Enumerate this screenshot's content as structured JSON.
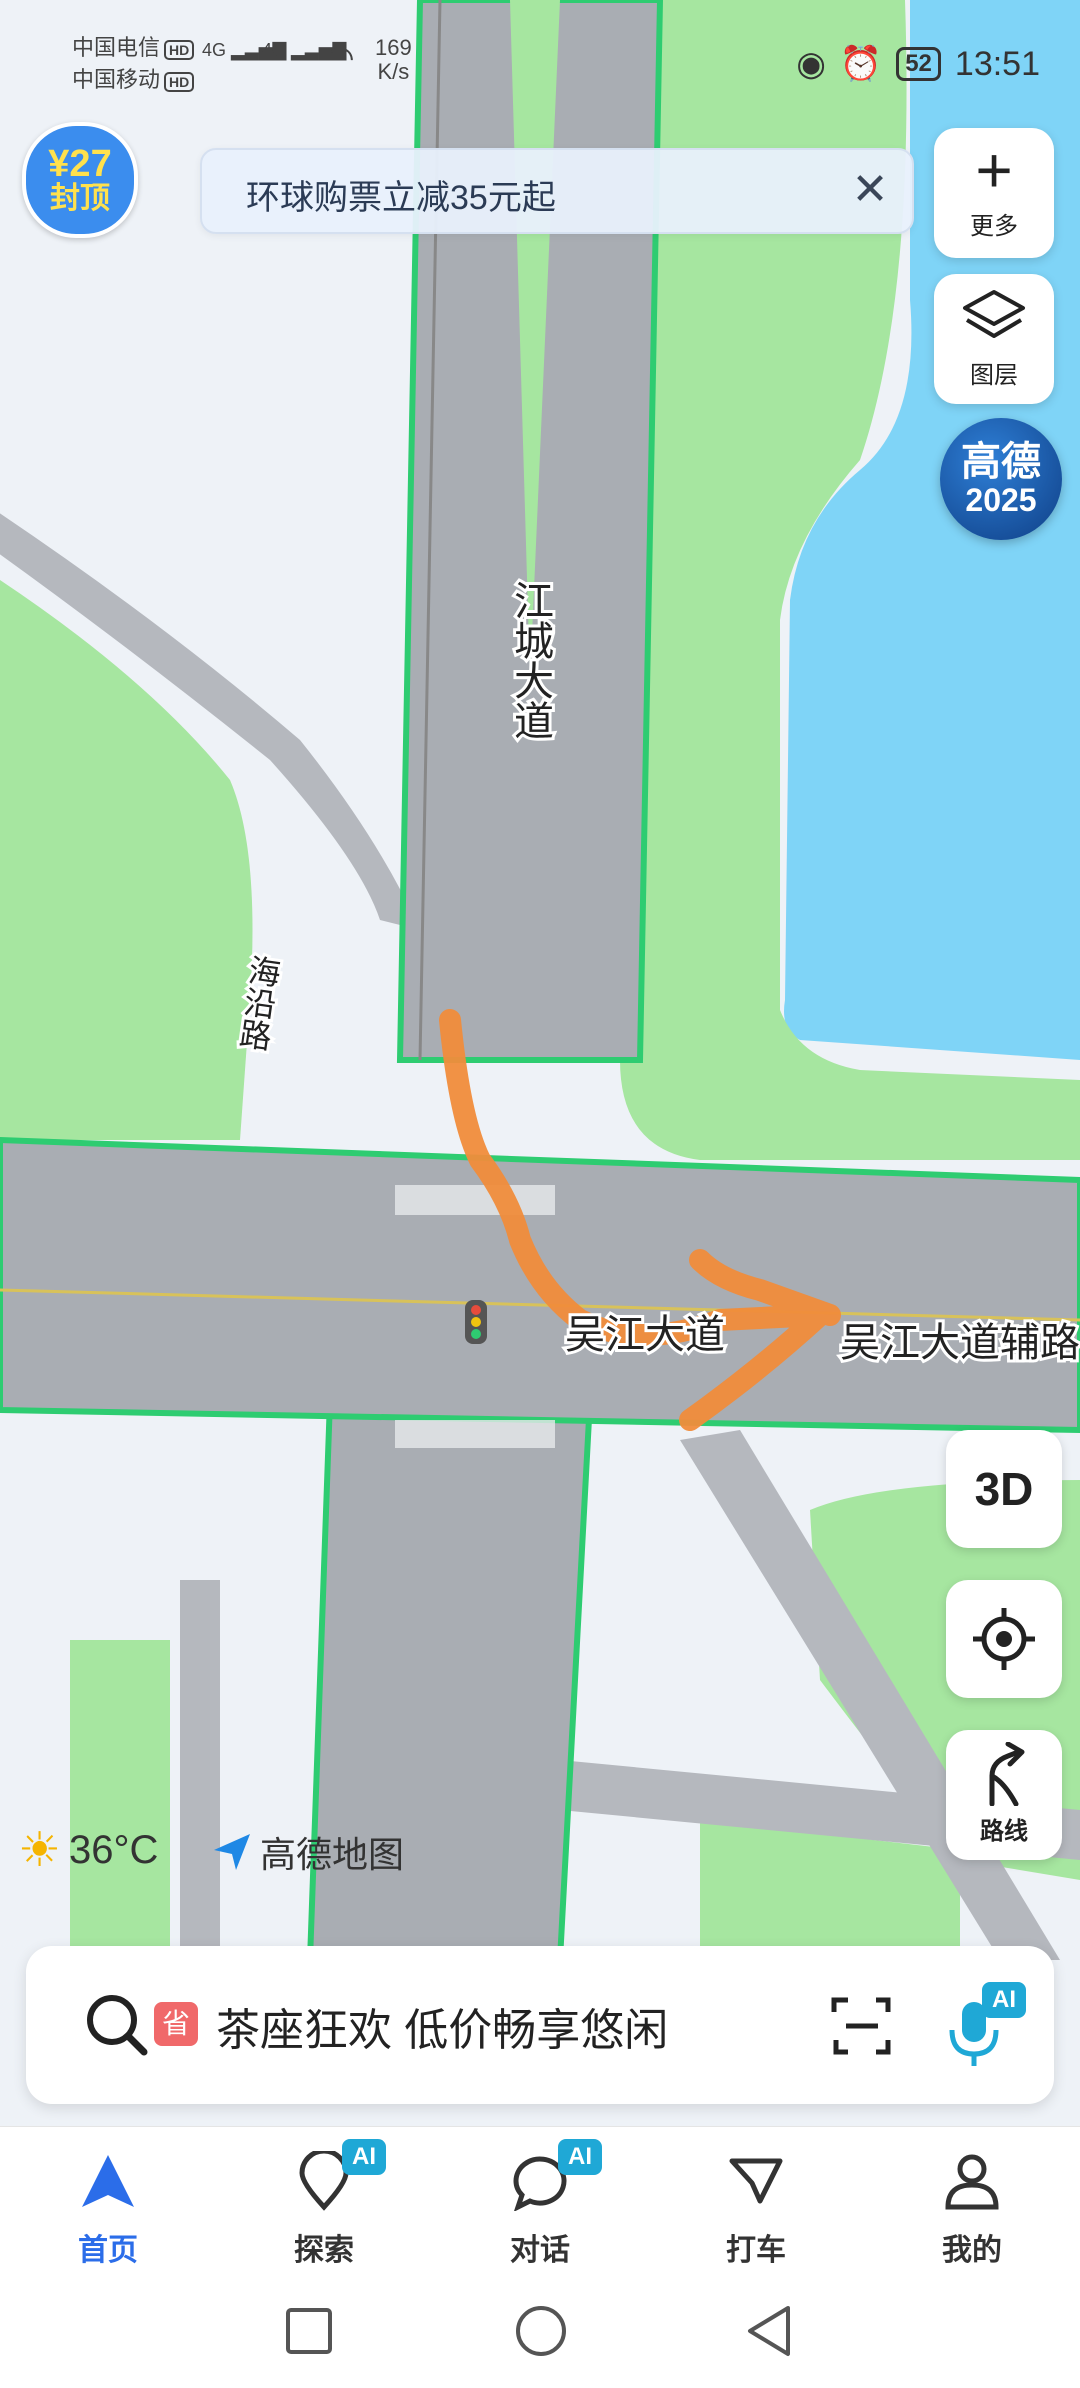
{
  "status_bar": {
    "carrier1": "中国电信",
    "carrier2": "中国移动",
    "hd_label": "HD",
    "net_label": "4G",
    "speed_value": "169",
    "speed_unit": "K/s",
    "battery": "52",
    "time": "13:51"
  },
  "promo_badge": {
    "line1": "¥27",
    "line2": "封顶"
  },
  "banner": {
    "text": "环球购票立减35元起"
  },
  "side_buttons": {
    "more_label": "更多",
    "layers_label": "图层"
  },
  "event_badge": {
    "line1": "高德",
    "line2": "2025"
  },
  "map": {
    "road_north": "江城大道",
    "road_west": "海沿路",
    "road_main": "吴江大道",
    "road_aux": "吴江大道辅路"
  },
  "controls": {
    "view_3d": "3D",
    "route_label": "路线"
  },
  "weather": {
    "temp": "36°C"
  },
  "logo": {
    "text": "高德地图"
  },
  "search": {
    "tag": "省",
    "placeholder": "茶座狂欢 低价畅享悠闲",
    "ai_label": "AI"
  },
  "tabs": [
    {
      "label": "首页",
      "active": true
    },
    {
      "label": "探索",
      "badge": "AI"
    },
    {
      "label": "对话",
      "badge": "AI"
    },
    {
      "label": "打车"
    },
    {
      "label": "我的"
    }
  ],
  "colors": {
    "accent": "#2b6de9",
    "road": "#a9adb3",
    "road_edge": "#2ecc71",
    "green": "#a6e6a0",
    "water": "#7fd4f7"
  }
}
